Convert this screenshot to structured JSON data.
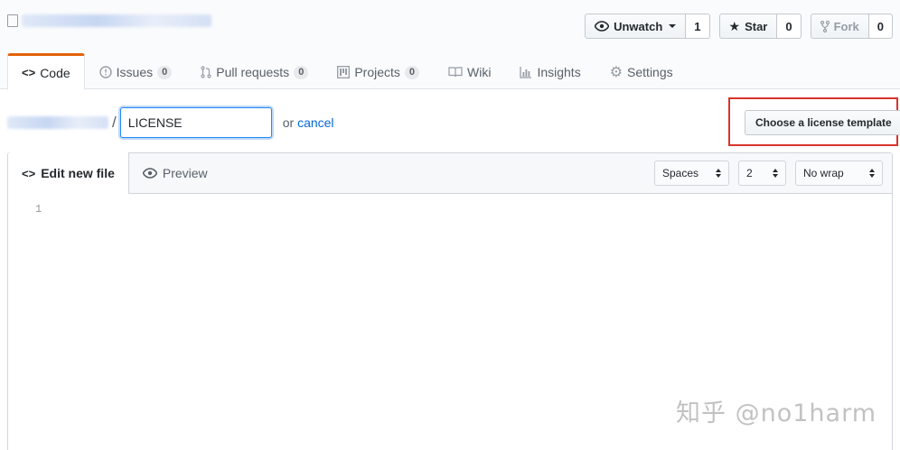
{
  "header": {
    "actions": [
      {
        "label": "Unwatch",
        "icon": "eye-icon",
        "count": "1",
        "has_caret": true
      },
      {
        "label": "Star",
        "icon": "star-icon",
        "count": "0",
        "has_caret": false
      },
      {
        "label": "Fork",
        "icon": "fork-icon",
        "count": "0",
        "has_caret": false,
        "disabled": true
      }
    ]
  },
  "tabs": [
    {
      "label": "Code",
      "icon": "code-icon",
      "selected": true
    },
    {
      "label": "Issues",
      "icon": "issue-icon",
      "count": "0"
    },
    {
      "label": "Pull requests",
      "icon": "pull-request-icon",
      "count": "0"
    },
    {
      "label": "Projects",
      "icon": "project-icon",
      "count": "0"
    },
    {
      "label": "Wiki",
      "icon": "book-icon"
    },
    {
      "label": "Insights",
      "icon": "graph-icon"
    },
    {
      "label": "Settings",
      "icon": "gear-icon"
    }
  ],
  "breadcrumb": {
    "separator": "/",
    "filename": "LICENSE",
    "or_text": "or",
    "cancel_label": "cancel"
  },
  "license_button": "Choose a license template",
  "editor": {
    "tabs": [
      {
        "label": "Edit new file",
        "icon": "code-icon",
        "selected": true
      },
      {
        "label": "Preview",
        "icon": "eye-icon"
      }
    ],
    "indent_mode": "Spaces",
    "indent_size": "2",
    "wrap_mode": "No wrap",
    "line_numbers": [
      "1"
    ]
  },
  "watermark": "知乎 @no1harm",
  "colors": {
    "highlight": "#d9342b",
    "selected_tab_accent": "#e36209",
    "link": "#0366d6"
  }
}
